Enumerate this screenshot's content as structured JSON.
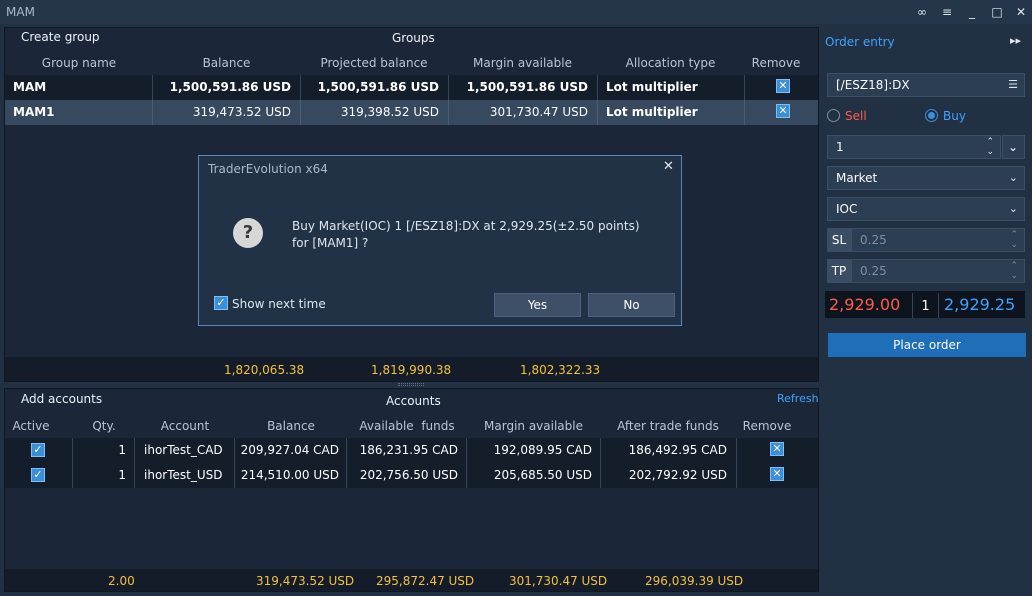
{
  "window": {
    "title": "MAM",
    "buttons": [
      "link-icon",
      "menu-icon",
      "minimize-icon",
      "maximize-icon",
      "close-icon"
    ]
  },
  "groups_panel": {
    "create_label": "Create group",
    "title": "Groups",
    "columns": [
      "Group name",
      "Balance",
      "Projected balance",
      "Margin available",
      "Allocation type",
      "Remove"
    ],
    "rows": [
      {
        "name": "MAM",
        "balance": "1,500,591.86 USD",
        "projected": "1,500,591.86 USD",
        "margin": "1,500,591.86 USD",
        "allocation": "Lot multiplier"
      },
      {
        "name": "MAM1",
        "balance": "319,473.52 USD",
        "projected": "319,398.52 USD",
        "margin": "301,730.47 USD",
        "allocation": "Lot multiplier"
      }
    ],
    "totals": {
      "balance": "1,820,065.38",
      "projected": "1,819,990.38",
      "margin": "1,802,322.33"
    }
  },
  "accounts_panel": {
    "add_label": "Add accounts",
    "title": "Accounts",
    "refresh_label": "Refresh",
    "columns": [
      "Active",
      "Qty.",
      "Account",
      "Balance",
      "Available  funds",
      "Margin available",
      "After trade funds",
      "Remove"
    ],
    "rows": [
      {
        "qty": "1",
        "account": "ihorTest_CAD",
        "balance": "209,927.04 CAD",
        "available": "186,231.95 CAD",
        "margin": "192,089.95 CAD",
        "after": "186,492.95 CAD"
      },
      {
        "qty": "1",
        "account": "ihorTest_USD",
        "balance": "214,510.00 USD",
        "available": "202,756.50 USD",
        "margin": "205,685.50 USD",
        "after": "202,792.92 USD"
      }
    ],
    "totals": {
      "qty": "2.00",
      "balance": "319,473.52 USD",
      "available": "295,872.47 USD",
      "margin": "301,730.47 USD",
      "after": "296,039.39 USD"
    }
  },
  "order_entry": {
    "title": "Order entry",
    "symbol": "[/ESZ18]:DX",
    "sell_label": "Sell",
    "buy_label": "Buy",
    "side_selected": "Buy",
    "quantity": "1",
    "order_type": "Market",
    "tif": "IOC",
    "sl_label": "SL",
    "sl_value": "0.25",
    "tp_label": "TP",
    "tp_value": "0.25",
    "bid": "2,929.00",
    "size": "1",
    "ask": "2,929.25",
    "place_label": "Place order",
    "colors": {
      "bid": "#ff5a4a",
      "ask": "#3fa3ff",
      "place": "#1f6fb8"
    }
  },
  "dialog": {
    "title": "TraderEvolution x64",
    "line1": "Buy Market(IOC) 1 [/ESZ18]:DX at 2,929.25(±2.50 points)",
    "line2": "for [MAM1] ?",
    "checkbox_label": "Show next time",
    "yes_label": "Yes",
    "no_label": "No"
  }
}
